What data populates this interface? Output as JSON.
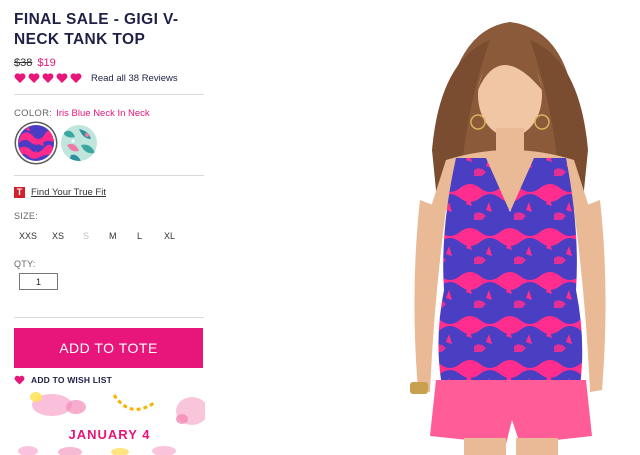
{
  "product": {
    "title": "FINAL SALE - GIGI V-NECK TANK TOP",
    "price_original": "$38",
    "price_sale": "$19",
    "rating_hearts": 5,
    "reviews_link": "Read all 38 Reviews"
  },
  "color": {
    "label": "COLOR:",
    "selected_value": "Iris Blue Neck In Neck",
    "swatches": [
      "iris-blue-swatch",
      "mint-print-swatch"
    ]
  },
  "fit": {
    "icon": "T",
    "link": "Find Your True Fit"
  },
  "size": {
    "label": "SIZE:",
    "options": [
      "XXS",
      "XS",
      "S",
      "M",
      "L",
      "XL"
    ],
    "unavailable": [
      "S"
    ]
  },
  "quantity": {
    "label": "QTY:",
    "value": "1"
  },
  "actions": {
    "add_to_tote": "ADD TO TOTE",
    "add_to_wishlist": "ADD TO WISH LIST"
  },
  "promo": {
    "text": "JANUARY 4"
  },
  "colors": {
    "brand_pink": "#e8157a",
    "navy_text": "#1e2046",
    "fit_red": "#d4202a"
  }
}
